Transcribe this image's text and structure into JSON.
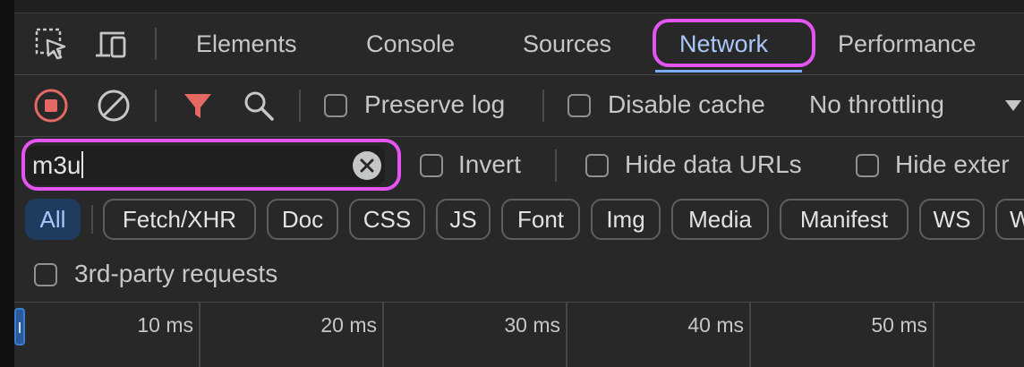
{
  "tabs": [
    {
      "label": "Elements"
    },
    {
      "label": "Console"
    },
    {
      "label": "Sources"
    },
    {
      "label": "Network"
    },
    {
      "label": "Performance"
    }
  ],
  "active_tab": "Network",
  "toolbar": {
    "preserve_log_label": "Preserve log",
    "disable_cache_label": "Disable cache",
    "throttling_value": "No throttling"
  },
  "filter": {
    "value": "m3u",
    "invert_label": "Invert",
    "hide_data_urls_label": "Hide data URLs",
    "hide_extensions_label": "Hide exter"
  },
  "type_filters": [
    {
      "label": "All"
    },
    {
      "label": "Fetch/XHR"
    },
    {
      "label": "Doc"
    },
    {
      "label": "CSS"
    },
    {
      "label": "JS"
    },
    {
      "label": "Font"
    },
    {
      "label": "Img"
    },
    {
      "label": "Media"
    },
    {
      "label": "Manifest"
    },
    {
      "label": "WS"
    },
    {
      "label": "W"
    }
  ],
  "third_party_label": "3rd-party requests",
  "timeline": {
    "ticks": [
      "10 ms",
      "20 ms",
      "30 ms",
      "40 ms",
      "50 ms"
    ]
  },
  "colors": {
    "highlight": "#e354f0",
    "active_tab_text": "#a8c7fa",
    "record_stop": "#e46962",
    "filter_funnel": "#e46962",
    "all_chip_bg": "#1f3b5e"
  },
  "icons": {
    "inspect": "select-element-icon",
    "device": "device-toolbar-icon",
    "record": "stop-recording-icon",
    "clear": "clear-log-icon",
    "filter": "filter-funnel-icon",
    "search": "search-icon",
    "dropdown": "dropdown-triangle-icon",
    "clear_input": "clear-input-icon"
  }
}
